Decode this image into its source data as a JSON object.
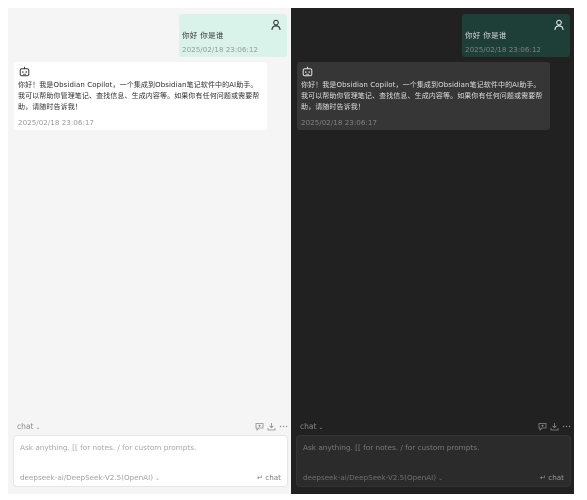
{
  "colors": {
    "light_bg": "#f5f5f5",
    "dark_bg": "#212121",
    "light_user_bubble": "#d9f2ea",
    "dark_user_bubble": "#1e3f37"
  },
  "messages": {
    "user_text": "你好 你是谁",
    "user_time": "2025/02/18 23:06:12",
    "bot_text": "你好！我是Obsidian Copilot，一个集成到Obsidian笔记软件中的AI助手。我可以帮助你管理笔记、查找信息、生成内容等。如果你有任何问题或需要帮助，请随时告诉我！",
    "bot_time": "2025/02/18 23:06:17"
  },
  "toolbar": {
    "mode_label": "chat",
    "mode_caret": "⌄",
    "icons": [
      "new-chat-icon",
      "download-icon",
      "more-icon"
    ]
  },
  "input": {
    "placeholder": "Ask anything. [[ for notes. / for custom prompts.",
    "model_label": "deepseek-ai/DeepSeek-V2.5(OpenAI)",
    "model_caret": "⌄",
    "send_label": "↵ chat"
  }
}
